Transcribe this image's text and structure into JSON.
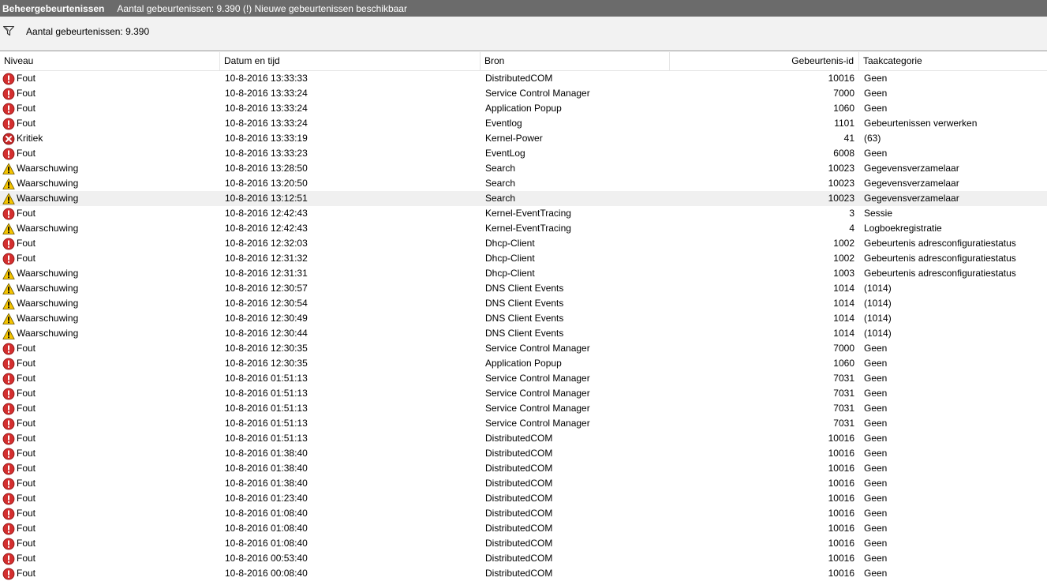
{
  "titlebar": {
    "title": "Beheergebeurtenissen",
    "info": "Aantal gebeurtenissen: 9.390 (!) Nieuwe gebeurtenissen beschikbaar"
  },
  "filterbar": {
    "count": "Aantal gebeurtenissen: 9.390"
  },
  "columns": {
    "level": "Niveau",
    "date": "Datum en tijd",
    "source": "Bron",
    "id": "Gebeurtenis-id",
    "category": "Taakcategorie"
  },
  "colors": {
    "error": "#d32f2f",
    "critical": "#c62828",
    "warning": "#f5c400",
    "selected_row": "#f0f0f0"
  },
  "level_icons": {
    "Fout": "error-icon",
    "Kritiek": "critical-icon",
    "Waarschuwing": "warning-icon"
  },
  "events": [
    {
      "level": "Fout",
      "date": "10-8-2016 13:33:33",
      "source": "DistributedCOM",
      "id": "10016",
      "category": "Geen"
    },
    {
      "level": "Fout",
      "date": "10-8-2016 13:33:24",
      "source": "Service Control Manager",
      "id": "7000",
      "category": "Geen"
    },
    {
      "level": "Fout",
      "date": "10-8-2016 13:33:24",
      "source": "Application Popup",
      "id": "1060",
      "category": "Geen"
    },
    {
      "level": "Fout",
      "date": "10-8-2016 13:33:24",
      "source": "Eventlog",
      "id": "1101",
      "category": "Gebeurtenissen verwerken"
    },
    {
      "level": "Kritiek",
      "date": "10-8-2016 13:33:19",
      "source": "Kernel-Power",
      "id": "41",
      "category": "(63)"
    },
    {
      "level": "Fout",
      "date": "10-8-2016 13:33:23",
      "source": "EventLog",
      "id": "6008",
      "category": "Geen"
    },
    {
      "level": "Waarschuwing",
      "date": "10-8-2016 13:28:50",
      "source": "Search",
      "id": "10023",
      "category": "Gegevensverzamelaar"
    },
    {
      "level": "Waarschuwing",
      "date": "10-8-2016 13:20:50",
      "source": "Search",
      "id": "10023",
      "category": "Gegevensverzamelaar"
    },
    {
      "level": "Waarschuwing",
      "date": "10-8-2016 13:12:51",
      "source": "Search",
      "id": "10023",
      "category": "Gegevensverzamelaar",
      "selected": true
    },
    {
      "level": "Fout",
      "date": "10-8-2016 12:42:43",
      "source": "Kernel-EventTracing",
      "id": "3",
      "category": "Sessie"
    },
    {
      "level": "Waarschuwing",
      "date": "10-8-2016 12:42:43",
      "source": "Kernel-EventTracing",
      "id": "4",
      "category": "Logboekregistratie"
    },
    {
      "level": "Fout",
      "date": "10-8-2016 12:32:03",
      "source": "Dhcp-Client",
      "id": "1002",
      "category": "Gebeurtenis adresconfiguratiestatus"
    },
    {
      "level": "Fout",
      "date": "10-8-2016 12:31:32",
      "source": "Dhcp-Client",
      "id": "1002",
      "category": "Gebeurtenis adresconfiguratiestatus"
    },
    {
      "level": "Waarschuwing",
      "date": "10-8-2016 12:31:31",
      "source": "Dhcp-Client",
      "id": "1003",
      "category": "Gebeurtenis adresconfiguratiestatus"
    },
    {
      "level": "Waarschuwing",
      "date": "10-8-2016 12:30:57",
      "source": "DNS Client Events",
      "id": "1014",
      "category": "(1014)"
    },
    {
      "level": "Waarschuwing",
      "date": "10-8-2016 12:30:54",
      "source": "DNS Client Events",
      "id": "1014",
      "category": "(1014)"
    },
    {
      "level": "Waarschuwing",
      "date": "10-8-2016 12:30:49",
      "source": "DNS Client Events",
      "id": "1014",
      "category": "(1014)"
    },
    {
      "level": "Waarschuwing",
      "date": "10-8-2016 12:30:44",
      "source": "DNS Client Events",
      "id": "1014",
      "category": "(1014)"
    },
    {
      "level": "Fout",
      "date": "10-8-2016 12:30:35",
      "source": "Service Control Manager",
      "id": "7000",
      "category": "Geen"
    },
    {
      "level": "Fout",
      "date": "10-8-2016 12:30:35",
      "source": "Application Popup",
      "id": "1060",
      "category": "Geen"
    },
    {
      "level": "Fout",
      "date": "10-8-2016 01:51:13",
      "source": "Service Control Manager",
      "id": "7031",
      "category": "Geen"
    },
    {
      "level": "Fout",
      "date": "10-8-2016 01:51:13",
      "source": "Service Control Manager",
      "id": "7031",
      "category": "Geen"
    },
    {
      "level": "Fout",
      "date": "10-8-2016 01:51:13",
      "source": "Service Control Manager",
      "id": "7031",
      "category": "Geen"
    },
    {
      "level": "Fout",
      "date": "10-8-2016 01:51:13",
      "source": "Service Control Manager",
      "id": "7031",
      "category": "Geen"
    },
    {
      "level": "Fout",
      "date": "10-8-2016 01:51:13",
      "source": "DistributedCOM",
      "id": "10016",
      "category": "Geen"
    },
    {
      "level": "Fout",
      "date": "10-8-2016 01:38:40",
      "source": "DistributedCOM",
      "id": "10016",
      "category": "Geen"
    },
    {
      "level": "Fout",
      "date": "10-8-2016 01:38:40",
      "source": "DistributedCOM",
      "id": "10016",
      "category": "Geen"
    },
    {
      "level": "Fout",
      "date": "10-8-2016 01:38:40",
      "source": "DistributedCOM",
      "id": "10016",
      "category": "Geen"
    },
    {
      "level": "Fout",
      "date": "10-8-2016 01:23:40",
      "source": "DistributedCOM",
      "id": "10016",
      "category": "Geen"
    },
    {
      "level": "Fout",
      "date": "10-8-2016 01:08:40",
      "source": "DistributedCOM",
      "id": "10016",
      "category": "Geen"
    },
    {
      "level": "Fout",
      "date": "10-8-2016 01:08:40",
      "source": "DistributedCOM",
      "id": "10016",
      "category": "Geen"
    },
    {
      "level": "Fout",
      "date": "10-8-2016 01:08:40",
      "source": "DistributedCOM",
      "id": "10016",
      "category": "Geen"
    },
    {
      "level": "Fout",
      "date": "10-8-2016 00:53:40",
      "source": "DistributedCOM",
      "id": "10016",
      "category": "Geen"
    },
    {
      "level": "Fout",
      "date": "10-8-2016 00:08:40",
      "source": "DistributedCOM",
      "id": "10016",
      "category": "Geen"
    }
  ]
}
